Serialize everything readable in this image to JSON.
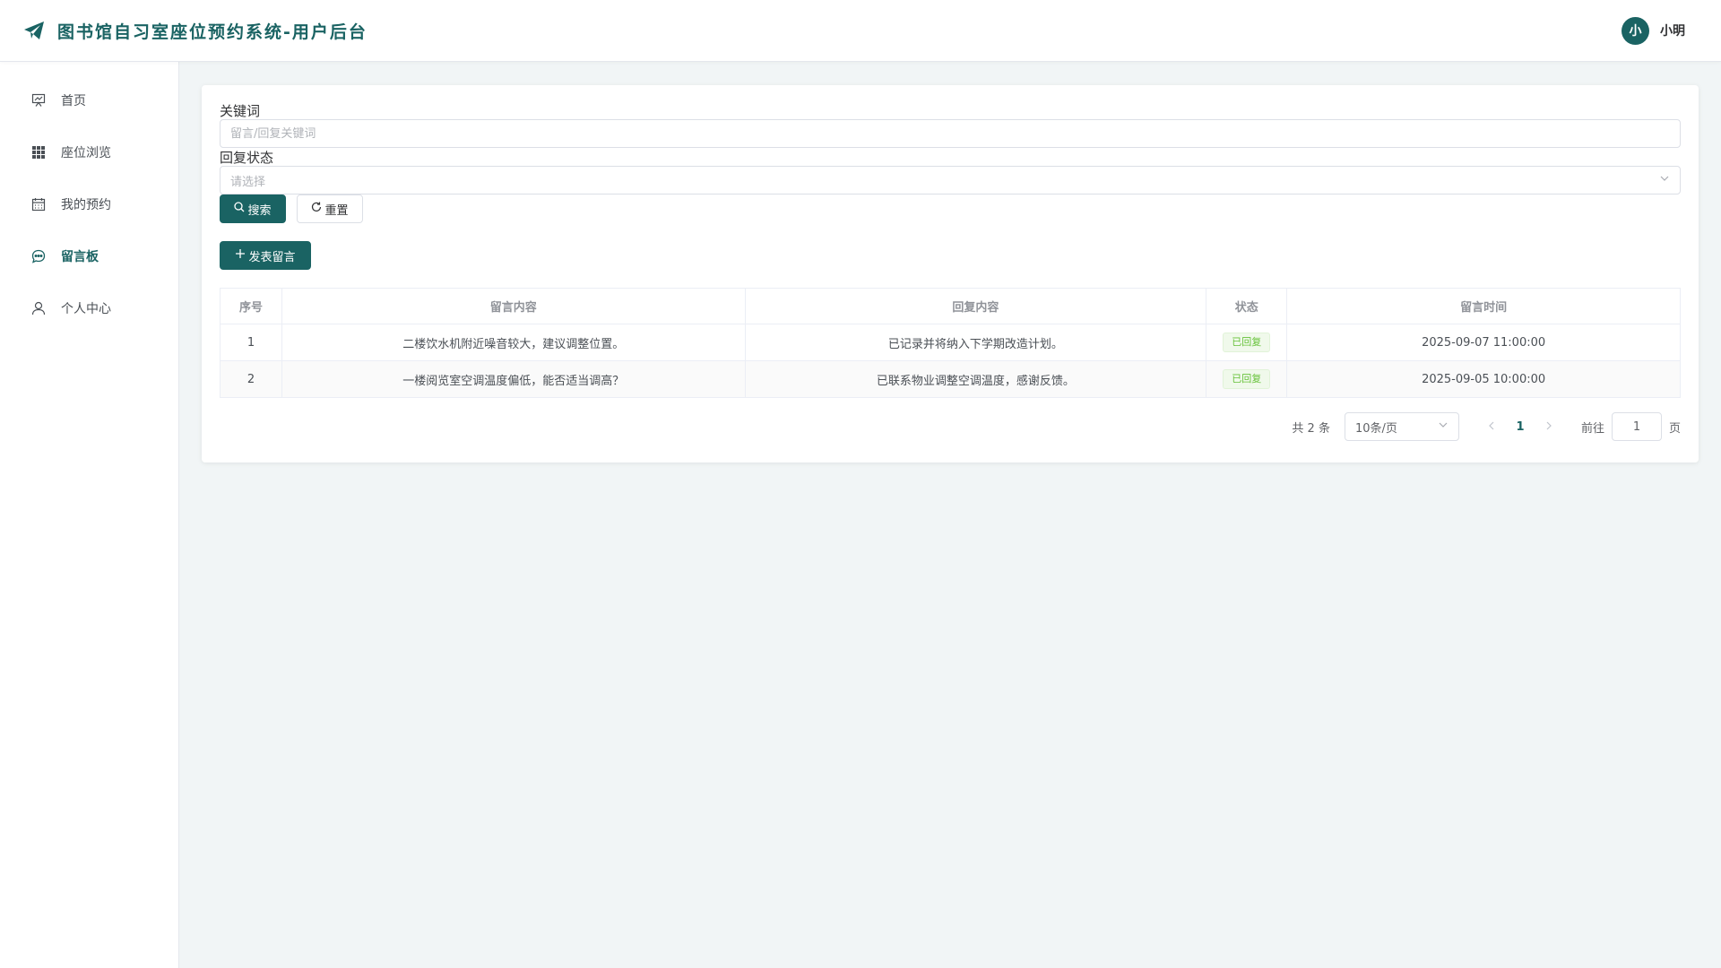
{
  "header": {
    "title": "图书馆自习室座位预约系统-用户后台",
    "avatar_text": "小",
    "user_name": "小明"
  },
  "sidebar": {
    "items": [
      {
        "label": "首页",
        "icon": "presentation-board-icon",
        "active": false
      },
      {
        "label": "座位浏览",
        "icon": "grid-icon",
        "active": false
      },
      {
        "label": "我的预约",
        "icon": "calendar-icon",
        "active": false
      },
      {
        "label": "留言板",
        "icon": "chat-bubble-icon",
        "active": true
      },
      {
        "label": "个人中心",
        "icon": "user-icon",
        "active": false
      }
    ]
  },
  "filters": {
    "keyword_label": "关键词",
    "keyword_placeholder": "留言/回复关键词",
    "keyword_value": "",
    "status_label": "回复状态",
    "status_placeholder": "请选择",
    "search_label": "搜索",
    "reset_label": "重置"
  },
  "toolbar": {
    "add_label": "发表留言"
  },
  "table": {
    "columns": [
      "序号",
      "留言内容",
      "回复内容",
      "状态",
      "留言时间"
    ],
    "rows": [
      {
        "index": "1",
        "content": "二楼饮水机附近噪音较大，建议调整位置。",
        "reply": "已记录并将纳入下学期改造计划。",
        "status": "已回复",
        "time": "2025-09-07 11:00:00"
      },
      {
        "index": "2",
        "content": "一楼阅览室空调温度偏低，能否适当调高？",
        "reply": "已联系物业调整空调温度，感谢反馈。",
        "status": "已回复",
        "time": "2025-09-05 10:00:00"
      }
    ]
  },
  "pagination": {
    "total_text": "共 2 条",
    "page_size": "10条/页",
    "current_page": "1",
    "goto_label": "前往",
    "jump_value": "1",
    "page_unit": "页"
  },
  "colors": {
    "primary": "#1a6363",
    "success": "#67c23a",
    "background": "#f1f5f6"
  }
}
